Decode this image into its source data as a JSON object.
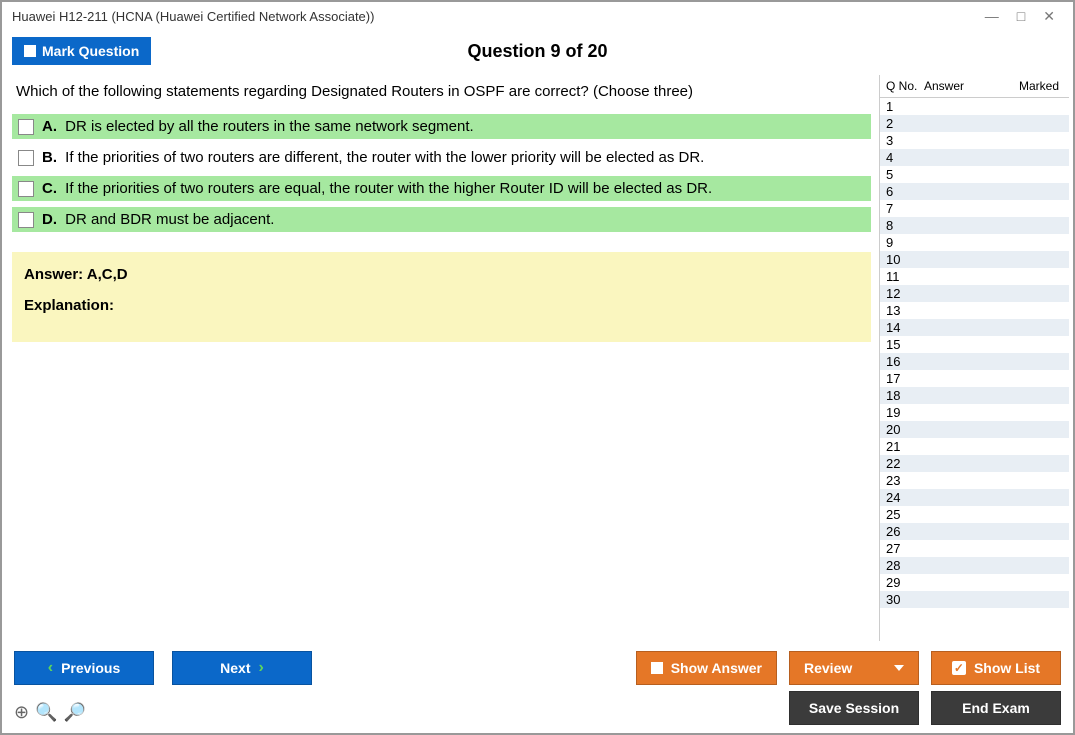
{
  "window": {
    "title": "Huawei H12-211 (HCNA (Huawei Certified Network Associate))"
  },
  "topbar": {
    "mark_label": "Mark Question",
    "question_title": "Question 9 of 20"
  },
  "question": {
    "text": "Which of the following statements regarding Designated Routers in OSPF are correct? (Choose three)",
    "options": {
      "a": {
        "letter": "A.",
        "text": "DR is elected by all the routers in the same network segment.",
        "is_correct": true
      },
      "b": {
        "letter": "B.",
        "text": "If the priorities of two routers are different, the router with the lower priority will be elected as DR.",
        "is_correct": false
      },
      "c": {
        "letter": "C.",
        "text": "If the priorities of two routers are equal, the router with the higher Router ID will be elected as DR.",
        "is_correct": true
      },
      "d": {
        "letter": "D.",
        "text": "DR and BDR must be adjacent.",
        "is_correct": true
      }
    }
  },
  "answer": {
    "label": "Answer: A,C,D",
    "explanation_label": "Explanation:"
  },
  "side": {
    "header": {
      "qno": "Q No.",
      "answer": "Answer",
      "marked": "Marked"
    },
    "rows": [
      "1",
      "2",
      "3",
      "4",
      "5",
      "6",
      "7",
      "8",
      "9",
      "10",
      "11",
      "12",
      "13",
      "14",
      "15",
      "16",
      "17",
      "18",
      "19",
      "20",
      "21",
      "22",
      "23",
      "24",
      "25",
      "26",
      "27",
      "28",
      "29",
      "30"
    ]
  },
  "buttons": {
    "previous": "Previous",
    "next": "Next",
    "show_answer": "Show Answer",
    "review": "Review",
    "show_list": "Show List",
    "save_session": "Save Session",
    "end_exam": "End Exam"
  }
}
